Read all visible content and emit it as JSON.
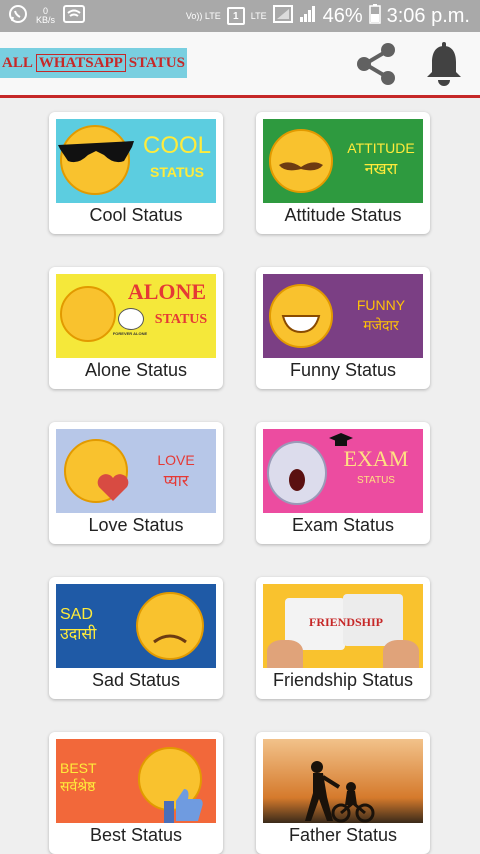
{
  "status_bar": {
    "signal_label": "0",
    "rate_label": "KB/s",
    "volte_label": "Vo)) LTE",
    "sim_label": "1",
    "lte_label": "LTE",
    "battery_percent": "46%",
    "time": "3:06 p.m."
  },
  "app_bar": {
    "logo_left": "ALL",
    "logo_mid": "WHATSAPP",
    "logo_right": "STATUS"
  },
  "categories": [
    {
      "label": "Cool Status",
      "thumb_line1": "COOL",
      "thumb_line2": "STATUS"
    },
    {
      "label": "Attitude Status",
      "thumb_line1": "ATTITUDE",
      "thumb_line2": "नखरा"
    },
    {
      "label": "Alone Status",
      "thumb_line1": "ALONE",
      "thumb_line2": "STATUS",
      "thumb_small": "FOREVER ALONE"
    },
    {
      "label": "Funny Status",
      "thumb_line1": "FUNNY",
      "thumb_line2": "मजेदार"
    },
    {
      "label": "Love Status",
      "thumb_line1": "LOVE",
      "thumb_line2": "प्यार"
    },
    {
      "label": "Exam Status",
      "thumb_line1": "EXAM",
      "thumb_line2": "STATUS"
    },
    {
      "label": "Sad Status",
      "thumb_line1": "SAD",
      "thumb_line2": "उदासी"
    },
    {
      "label": "Friendship Status",
      "thumb_line1": "FRIENDSHIP"
    },
    {
      "label": "Best Status",
      "thumb_line1": "BEST",
      "thumb_line2": "सर्वश्रेष्ठ"
    },
    {
      "label": "Father Status"
    }
  ],
  "colors": {
    "accent_red": "#c62828",
    "logo_bg": "#79cfe0",
    "status_bar": "#a9a9a9"
  }
}
